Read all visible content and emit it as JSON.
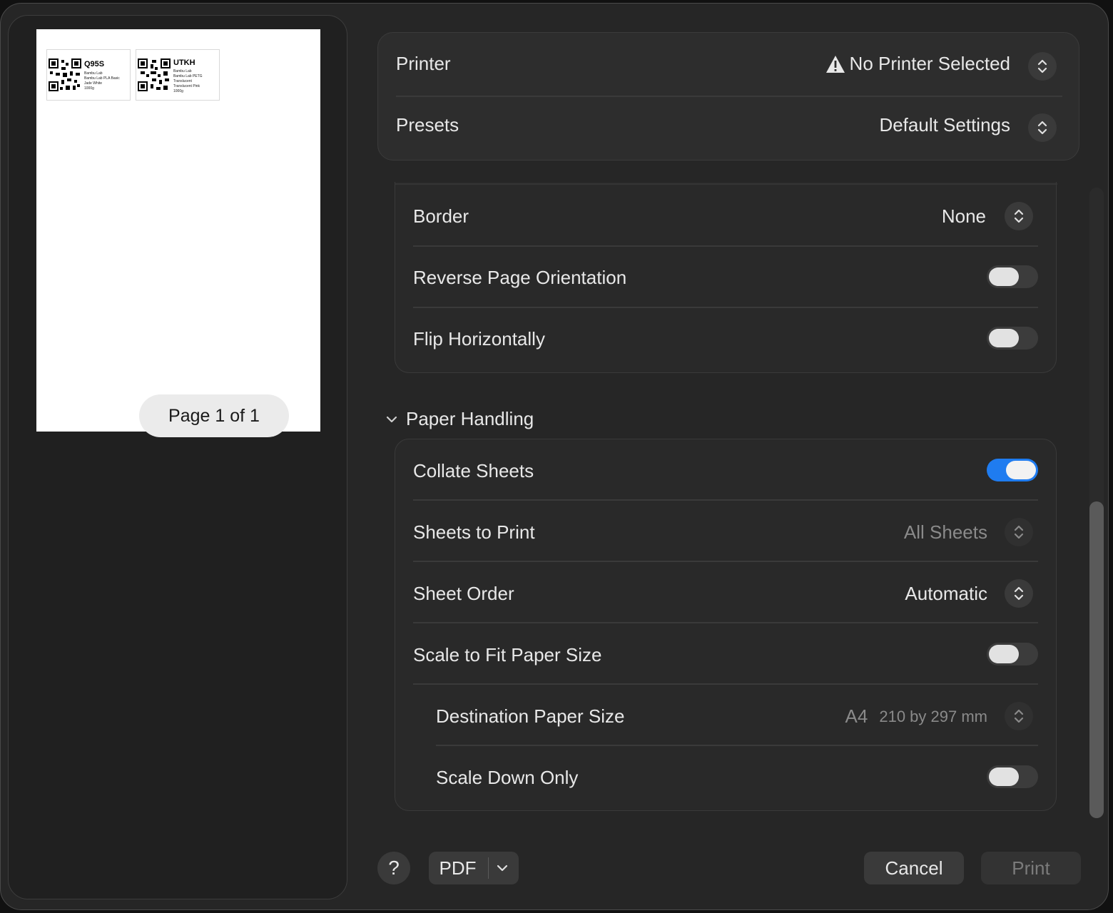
{
  "preview": {
    "labels": [
      {
        "code": "Q95S",
        "lines": [
          "Bambu Lab",
          "Bambu Lab PLA Basic",
          "Jade White",
          "1000g"
        ]
      },
      {
        "code": "UTKH",
        "lines": [
          "Bambu Lab",
          "Bambu Lab PETG",
          "Translucent",
          "Translucent Pink",
          "1000g"
        ]
      }
    ],
    "page_indicator": "Page 1 of 1"
  },
  "printer": {
    "label": "Printer",
    "value": "No Printer Selected",
    "warning_icon": "warning-triangle-icon"
  },
  "presets": {
    "label": "Presets",
    "value": "Default Settings"
  },
  "layout": {
    "border": {
      "label": "Border",
      "value": "None"
    },
    "reverse_orientation": {
      "label": "Reverse Page Orientation",
      "on": false
    },
    "flip_horizontally": {
      "label": "Flip Horizontally",
      "on": false
    }
  },
  "paper_handling": {
    "title": "Paper Handling",
    "collate": {
      "label": "Collate Sheets",
      "on": true
    },
    "sheets_to_print": {
      "label": "Sheets to Print",
      "value": "All Sheets"
    },
    "sheet_order": {
      "label": "Sheet Order",
      "value": "Automatic"
    },
    "scale_to_fit": {
      "label": "Scale to Fit Paper Size",
      "on": false
    },
    "destination_size": {
      "label": "Destination Paper Size",
      "value": "A4",
      "detail": "210 by 297 mm"
    },
    "scale_down_only": {
      "label": "Scale Down Only",
      "on": false
    }
  },
  "footer": {
    "help": "?",
    "pdf": "PDF",
    "cancel": "Cancel",
    "print": "Print"
  },
  "colors": {
    "accent": "#1f7cf0",
    "background": "#262626"
  }
}
